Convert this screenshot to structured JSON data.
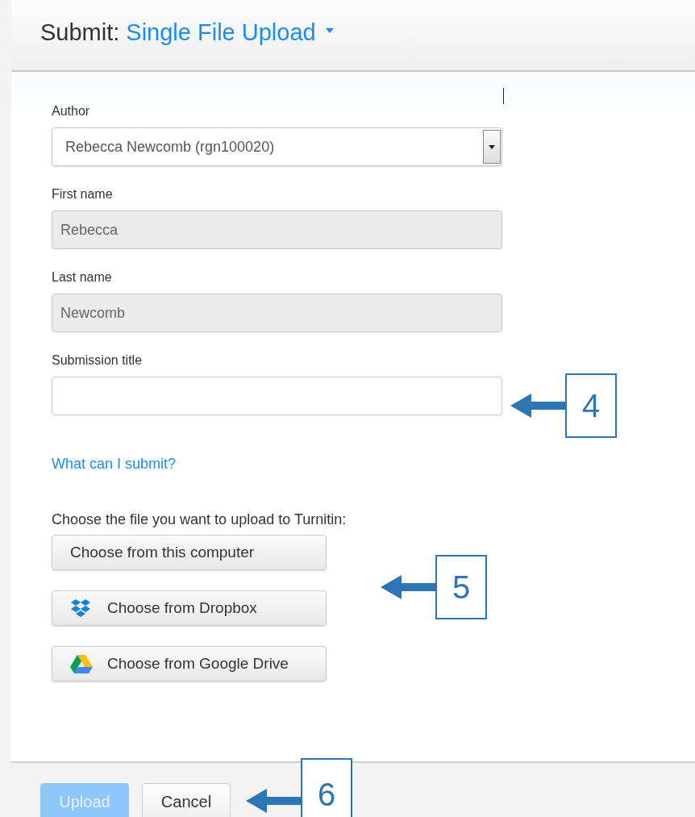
{
  "header": {
    "prefix": "Submit:",
    "title": "Single File Upload"
  },
  "fields": [
    {
      "label": "Author",
      "kind": "select",
      "value": "Rebecca Newcomb (rgn100020)",
      "disabled": false
    },
    {
      "label": "First name",
      "kind": "text",
      "value": "Rebecca",
      "disabled": true
    },
    {
      "label": "Last name",
      "kind": "text",
      "value": "Newcomb",
      "disabled": true
    },
    {
      "label": "Submission title",
      "kind": "text",
      "disabled": false
    }
  ],
  "help_link": "What can I submit?",
  "upload_prompt": "Choose the file you want to upload to Turnitin:",
  "sources": [
    {
      "label": "Choose from this computer",
      "kind": "computer"
    },
    {
      "label": "Choose from Dropbox",
      "kind": "dropbox"
    },
    {
      "label": "Choose from Google Drive",
      "kind": "drive"
    }
  ],
  "footer_buttons": [
    {
      "label": "Upload",
      "kind": "primary",
      "disabled": true
    },
    {
      "label": "Cancel",
      "kind": "default",
      "disabled": false
    }
  ],
  "callouts": [
    {
      "label": "4",
      "kind": "field"
    },
    {
      "label": "5",
      "kind": "sources"
    },
    {
      "label": "6",
      "kind": "footer"
    }
  ]
}
